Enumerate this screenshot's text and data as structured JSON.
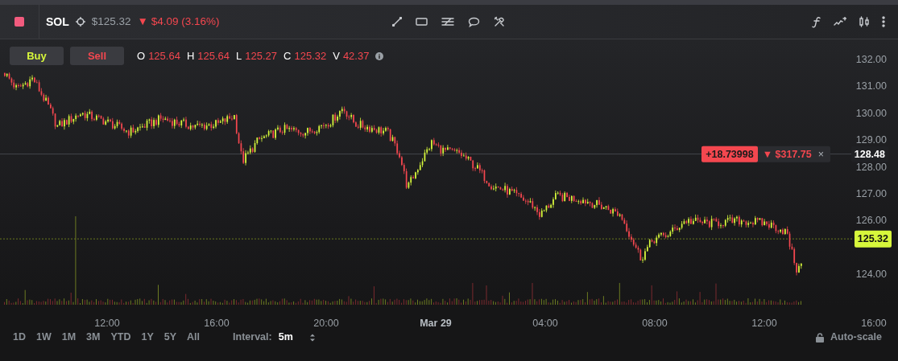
{
  "header": {
    "symbol": "SOL",
    "price": "$125.32",
    "change_arrow": "▼",
    "change": "$4.09 (3.16%)"
  },
  "trade_buttons": [
    {
      "label": "Buy",
      "kind": "buy"
    },
    {
      "label": "Sell",
      "kind": "sell"
    }
  ],
  "ohlcv": [
    {
      "label": "O",
      "value": "125.64"
    },
    {
      "label": "H",
      "value": "125.64"
    },
    {
      "label": "L",
      "value": "125.27"
    },
    {
      "label": "C",
      "value": "125.32"
    },
    {
      "label": "V",
      "value": "42.37"
    }
  ],
  "price_axis": [
    "132.00",
    "131.00",
    "130.00",
    "129.00",
    "128.00",
    "127.00",
    "126.00",
    "124.00"
  ],
  "position_line": {
    "pnl": "+18.73998",
    "arrow": "▼",
    "amount": "$317.75",
    "close": "×",
    "price": "128.48"
  },
  "last_price": "125.32",
  "time_axis": [
    {
      "label": "12:00",
      "bold": false
    },
    {
      "label": "16:00",
      "bold": false
    },
    {
      "label": "20:00",
      "bold": false
    },
    {
      "label": "Mar 29",
      "bold": true
    },
    {
      "label": "04:00",
      "bold": false
    },
    {
      "label": "08:00",
      "bold": false
    },
    {
      "label": "12:00",
      "bold": false
    },
    {
      "label": "16:00",
      "bold": false
    }
  ],
  "ranges": [
    "1D",
    "1W",
    "1M",
    "3M",
    "YTD",
    "1Y",
    "5Y",
    "All"
  ],
  "interval": {
    "label": "Interval:",
    "value": "5m"
  },
  "autoscale": "Auto-scale"
}
